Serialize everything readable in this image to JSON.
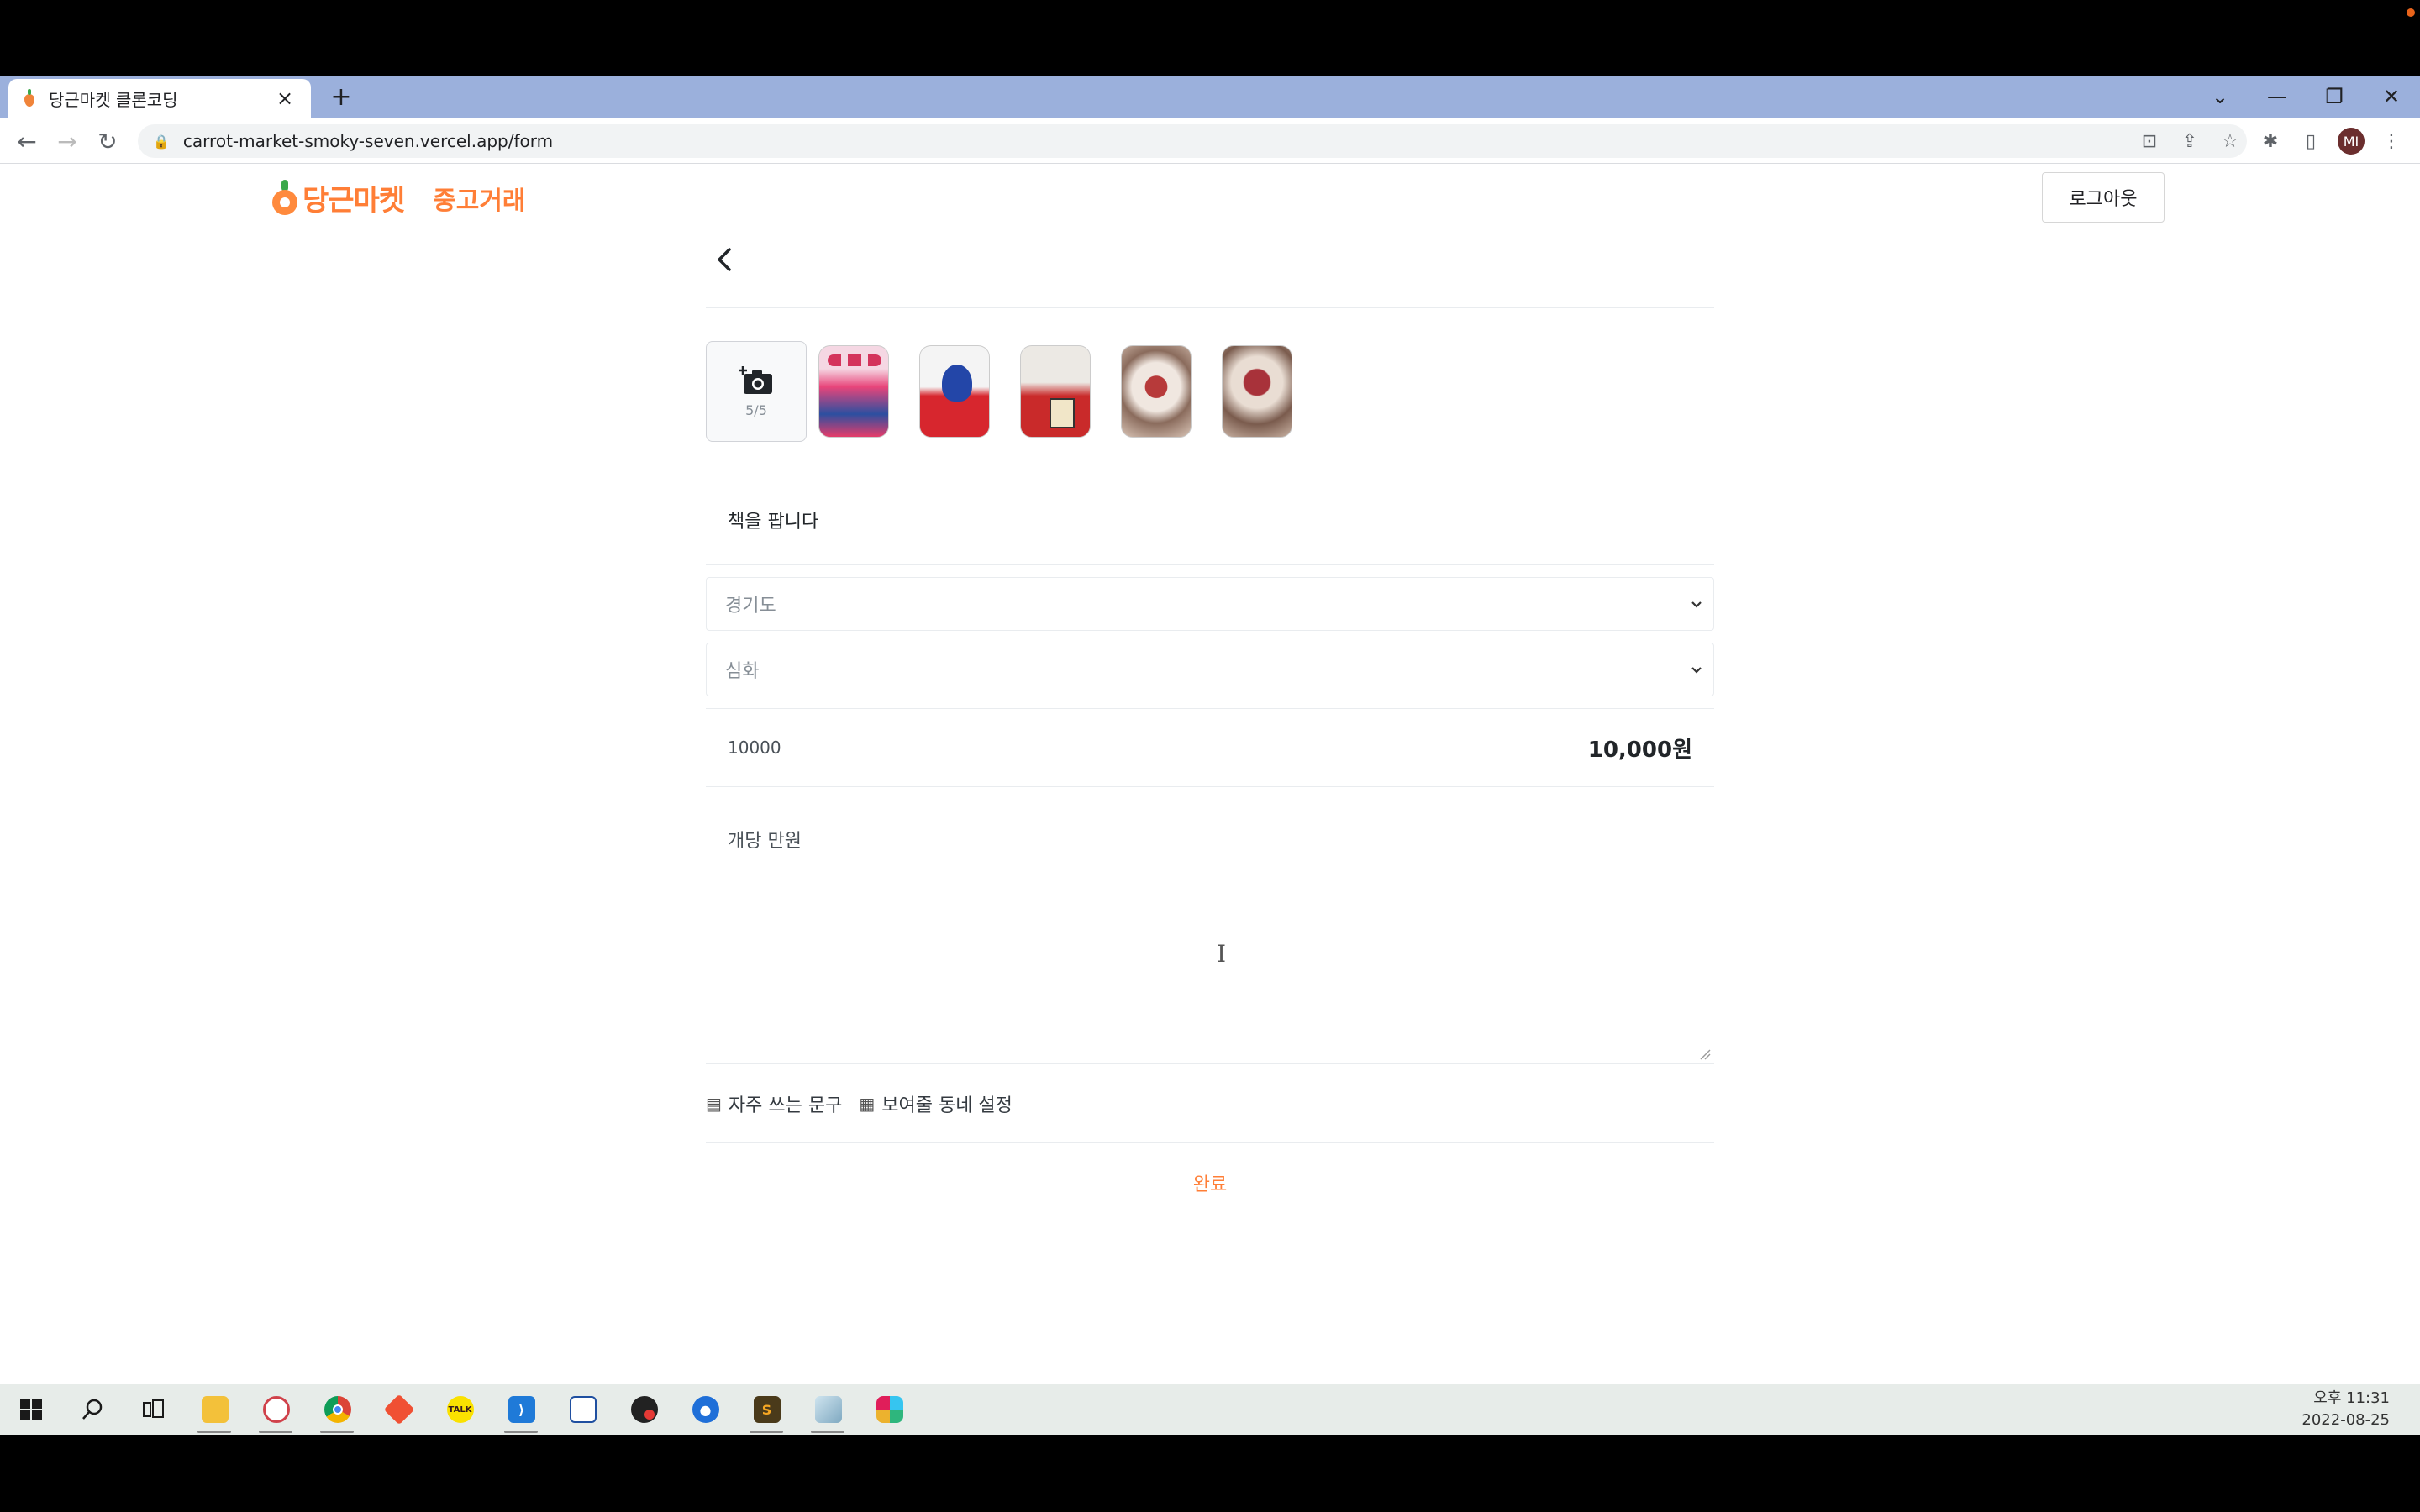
{
  "browser": {
    "tab_title": "당근마켓 클론코딩",
    "tab_close": "×",
    "new_tab": "+",
    "url": "carrot-market-smoky-seven.vercel.app/form",
    "profile_initials": "MI"
  },
  "header": {
    "brand": "당근마켓",
    "section": "중고거래",
    "logout_label": "로그아웃"
  },
  "form": {
    "photo_count": "5/5",
    "title_value": "책을 팝니다",
    "region_selected": "경기도",
    "district_selected": "심화",
    "price_input": "10000",
    "price_formatted": "10,000원",
    "description_value": "개당 만원",
    "frequent_phrases_label": "자주 쓰는 문구",
    "neighborhood_label": "보여줄 동네 설정",
    "submit_label": "완료"
  },
  "colors": {
    "brand": "#ff7e36"
  },
  "taskbar": {
    "time": "오후 11:31",
    "date": "2022-08-25",
    "apps": [
      "windows-start-icon",
      "search-icon",
      "task-view-icon",
      "file-explorer-icon",
      "paint-icon",
      "chrome-icon",
      "git-icon",
      "kakaotalk-icon",
      "vscode-icon",
      "snipping-icon",
      "app-icon",
      "maps-icon",
      "sublime-icon",
      "app-icon-2",
      "slack-icon"
    ]
  }
}
